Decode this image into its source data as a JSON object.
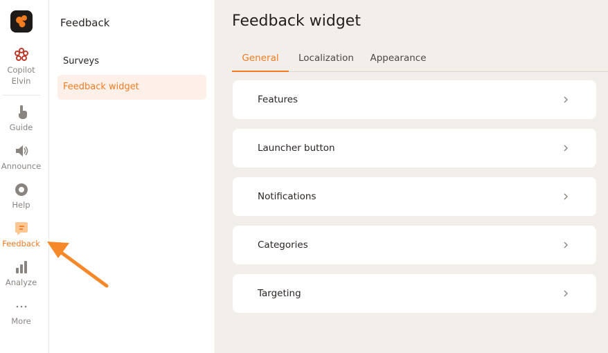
{
  "rail": {
    "items": [
      {
        "label_line1": "Copilot",
        "label_line2": "Elvin",
        "icon": "copilot-flower-icon"
      },
      {
        "label": "Guide",
        "icon": "pointer-hand-icon"
      },
      {
        "label": "Announce",
        "icon": "speaker-icon"
      },
      {
        "label": "Help",
        "icon": "lifebuoy-icon"
      },
      {
        "label": "Feedback",
        "icon": "feedback-chat-icon",
        "active": true
      },
      {
        "label": "Analyze",
        "icon": "bar-chart-icon"
      },
      {
        "label": "More",
        "icon": "more-dots-icon"
      }
    ]
  },
  "subnav": {
    "title": "Feedback",
    "items": [
      {
        "label": "Surveys"
      },
      {
        "label": "Feedback widget",
        "active": true
      }
    ]
  },
  "main": {
    "title": "Feedback widget",
    "tabs": [
      {
        "label": "General",
        "active": true
      },
      {
        "label": "Localization"
      },
      {
        "label": "Appearance"
      }
    ],
    "cards": [
      {
        "label": "Features"
      },
      {
        "label": "Launcher button"
      },
      {
        "label": "Notifications"
      },
      {
        "label": "Categories"
      },
      {
        "label": "Targeting"
      }
    ]
  },
  "colors": {
    "accent": "#f27b22",
    "background": "#f2eeea",
    "logo_bg": "#1e1a17",
    "copilot_red": "#c0392b"
  }
}
